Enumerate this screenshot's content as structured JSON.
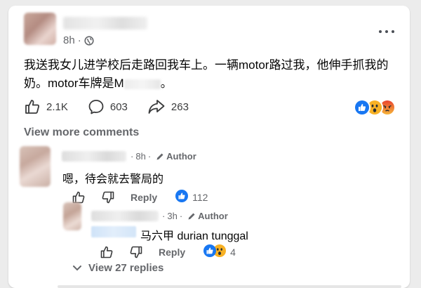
{
  "post": {
    "time": "8h",
    "text_line1": "我送我女儿进学校后走路回我车上。一辆motor路过我，他伸手抓我的",
    "text_line2_a": "奶。motor车牌是M",
    "text_line2_b": "。",
    "likes": "2.1K",
    "comments": "603",
    "shares": "263",
    "reactions": [
      "like",
      "wow",
      "angry"
    ]
  },
  "view_more_comments": "View more comments",
  "comments": [
    {
      "time": "8h",
      "badge": "Author",
      "text": "嗯，待会就去警局的",
      "reply_label": "Reply",
      "reaction_count": "112"
    },
    {
      "time": "3h",
      "badge": "Author",
      "text": "马六甲 durian tunggal",
      "reply_label": "Reply",
      "reaction_count": "4"
    }
  ],
  "view_replies": "View 27 replies",
  "colors": {
    "like_blue": "#1877f2",
    "wow_yellow": "#f7b125",
    "angry_red": "#e9710f",
    "meta_gray": "#65676b"
  }
}
